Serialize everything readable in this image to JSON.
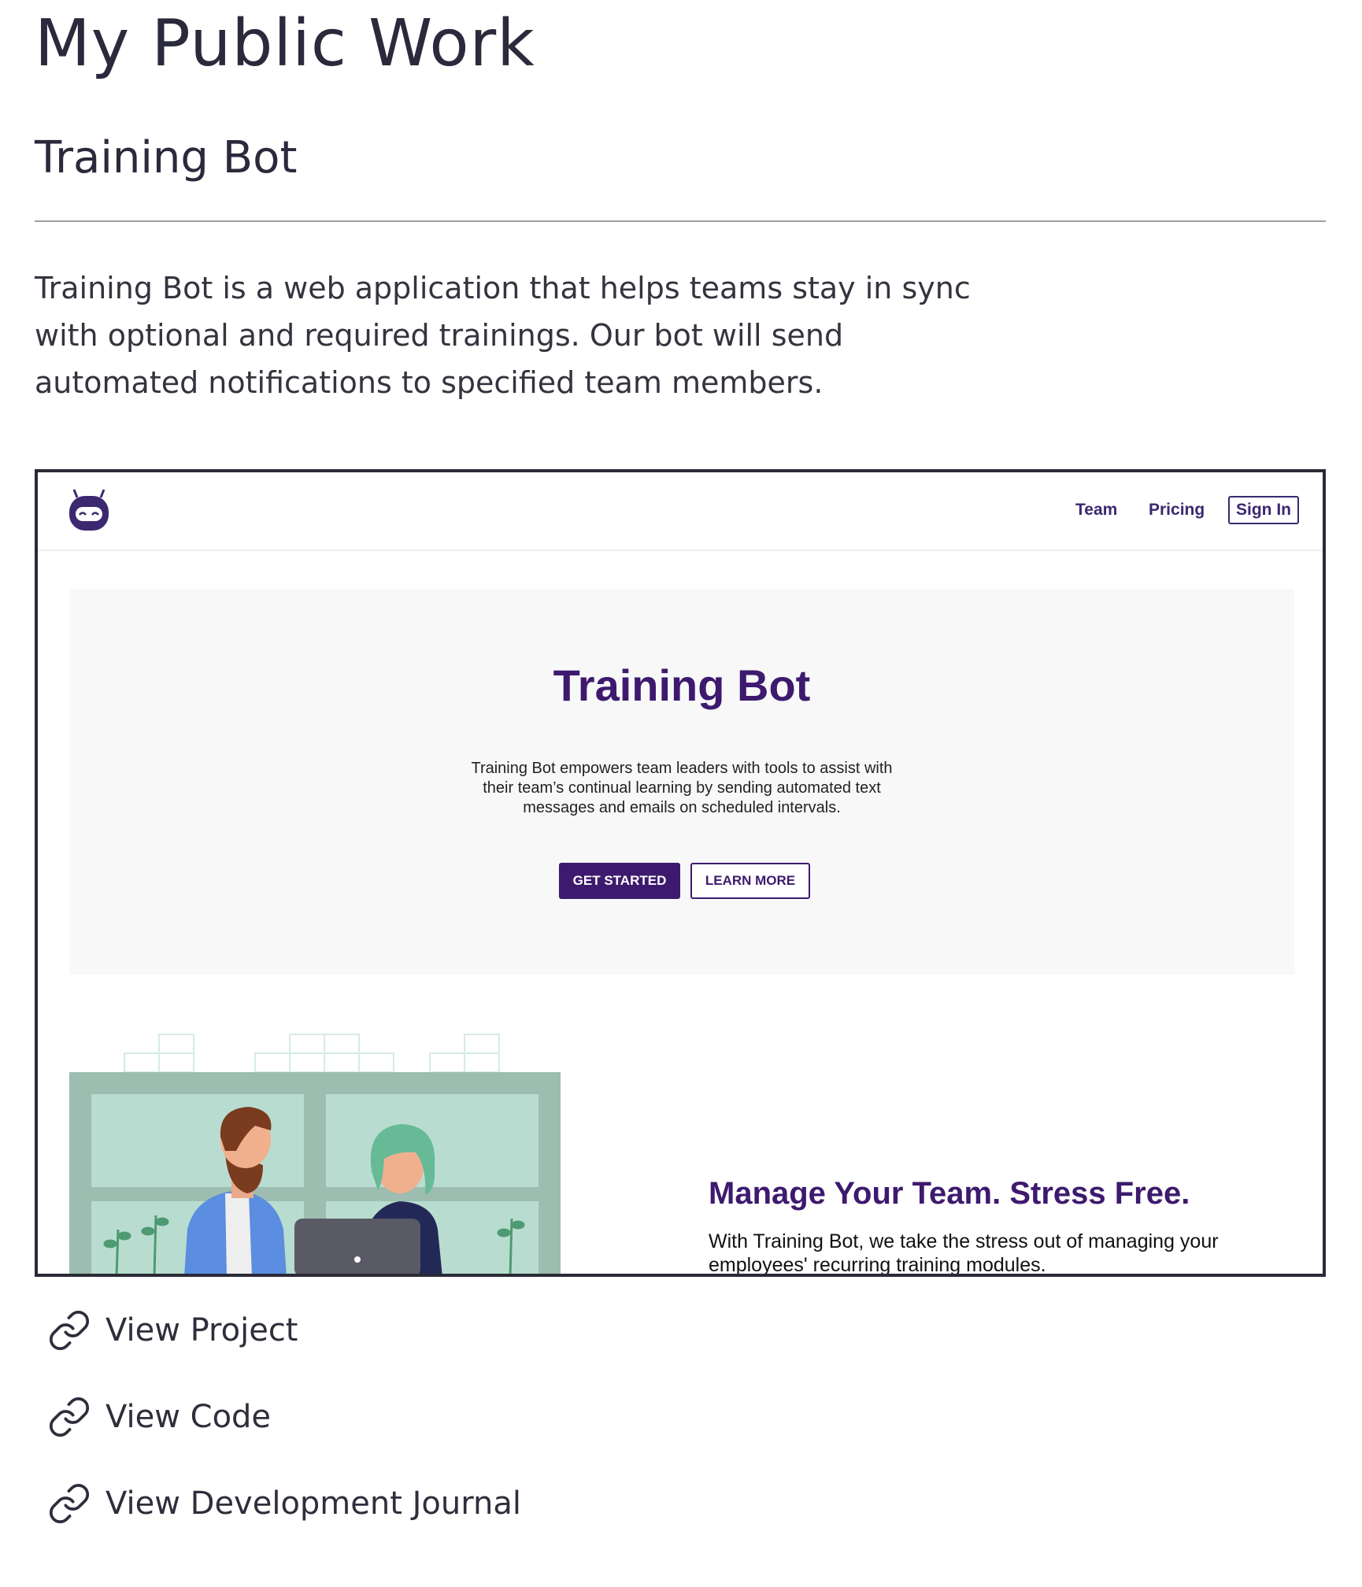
{
  "page": {
    "title": "My Public Work"
  },
  "project": {
    "title": "Training Bot",
    "description": "Training Bot is a web application that helps teams stay in sync with optional and required trainings. Our bot will send automated notifications to specified team members."
  },
  "screenshot": {
    "nav": {
      "logo_icon": "robot-icon",
      "items": [
        {
          "label": "Team"
        },
        {
          "label": "Pricing"
        }
      ],
      "signin_label": "Sign In"
    },
    "hero": {
      "title": "Training Bot",
      "text": "Training Bot empowers team leaders with tools to assist with their team’s continual learning by sending automated text messages and emails on scheduled intervals.",
      "primary_button": "GET STARTED",
      "secondary_button": "LEARN MORE"
    },
    "section": {
      "title": "Manage Your Team. Stress Free.",
      "text": "With Training Bot, we take the stress out of managing your employees' recurring training modules."
    },
    "illustration_icon": "office-team-illustration"
  },
  "links": [
    {
      "label": "View Project",
      "icon": "link-icon"
    },
    {
      "label": "View Code",
      "icon": "link-icon"
    },
    {
      "label": "View Development Journal",
      "icon": "link-icon"
    }
  ],
  "colors": {
    "brand_purple": "#3d1a6e",
    "text_dark": "#2a2a3c",
    "divider": "#9e9ea4",
    "hero_bg": "#f8f8f8"
  }
}
